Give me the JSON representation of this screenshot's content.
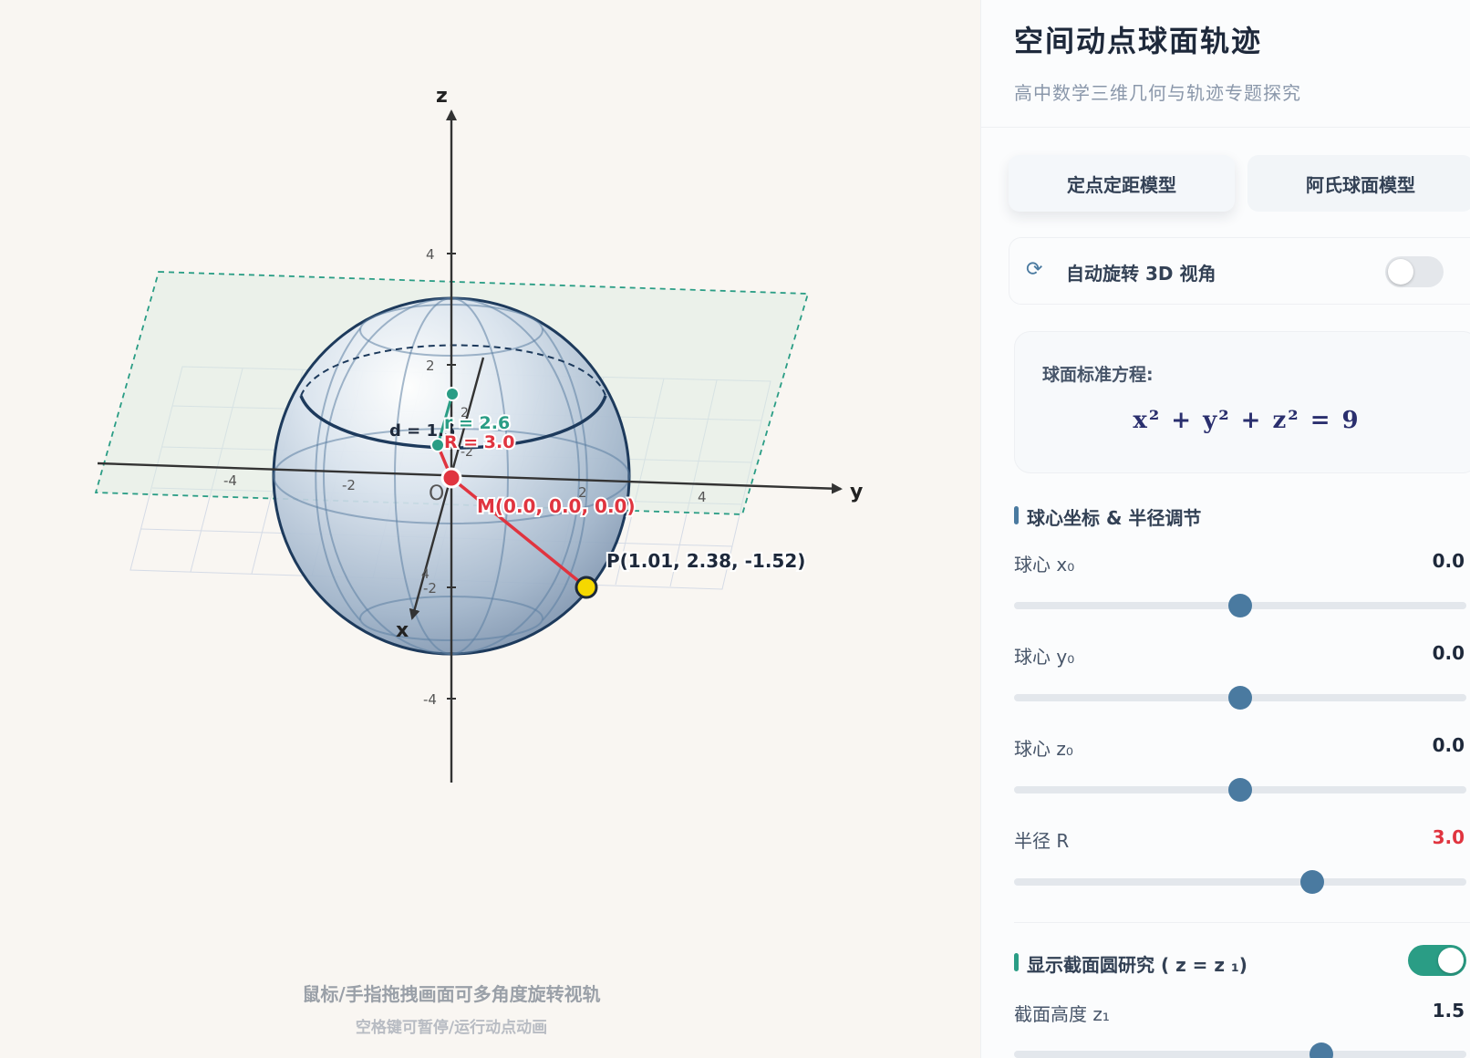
{
  "app": {
    "title": "空间动点球面轨迹",
    "subtitle": "高中数学三维几何与轨迹专题探究"
  },
  "tabs": [
    {
      "label": "定点定距模型",
      "active": true
    },
    {
      "label": "阿氏球面模型",
      "active": false
    }
  ],
  "auto_rotate": {
    "icon": "rotate-icon",
    "label": "自动旋转 3D 视角",
    "enabled": false
  },
  "equation": {
    "label": "球面标准方程:",
    "text": "x² + y² + z² = 9"
  },
  "center_section": {
    "title": "球心坐标 & 半径调节",
    "accent": "#4a7aa0",
    "params": [
      {
        "label": "球心 x₀",
        "value": "0.0",
        "fraction": 0.5
      },
      {
        "label": "球心 y₀",
        "value": "0.0",
        "fraction": 0.5
      },
      {
        "label": "球心 z₀",
        "value": "0.0",
        "fraction": 0.5
      },
      {
        "label": "半径 R",
        "value": "3.0",
        "fraction": 0.66,
        "highlight": "#e0343f"
      }
    ]
  },
  "cross_section": {
    "title": "显示截面圆研究 ( z = z ₁)",
    "accent": "#2a9d85",
    "enabled": true,
    "param": {
      "label": "截面高度 z₁",
      "value": "1.5",
      "fraction": 0.68
    }
  },
  "viewport": {
    "axis_labels": {
      "x": "x",
      "y": "y",
      "z": "z",
      "origin": "O"
    },
    "ticks": {
      "z": [
        "4",
        "2",
        "-2",
        "-4"
      ],
      "y": [
        "-4",
        "-2",
        "2",
        "4"
      ],
      "x": [
        "2",
        "-2",
        "4"
      ]
    },
    "labels": {
      "distance": "d = 1.5",
      "small_radius": "r = 2.6",
      "big_radius": "R = 3.0",
      "center": "M(0.0, 0.0, 0.0)",
      "point": "P(1.01, 2.38, -1.52)"
    },
    "hint_main": "鼠标/手指拖拽画面可多角度旋转视轨",
    "hint_sub": "空格键可暂停/运行动点动画",
    "colors": {
      "radius_line": "#e0343f",
      "section_point": "#2a9d85",
      "moving_point": "#f5d800",
      "sphere_outline": "#1d3a5c"
    }
  }
}
